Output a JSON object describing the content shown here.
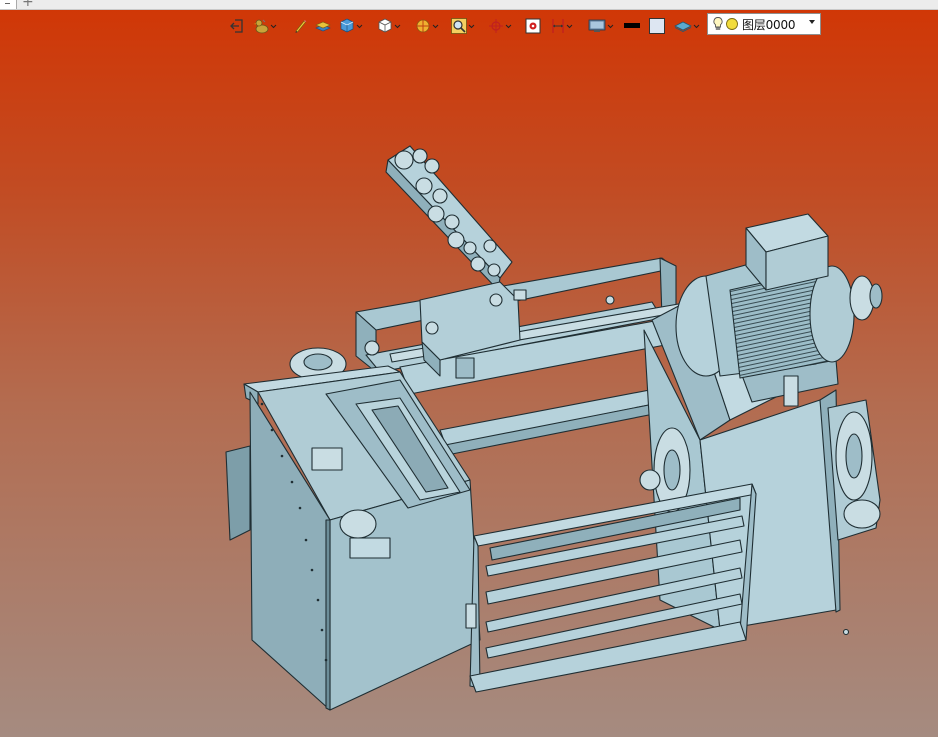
{
  "tab_strip": {
    "new_tab_label": "+"
  },
  "toolbar": {
    "icons": [
      "exit-icon",
      "duck-icon",
      "pencil-icon",
      "layers-icon",
      "cube-blue-icon",
      "cube-white-icon",
      "section-icon",
      "zoom-icon",
      "crosshair-icon",
      "target-icon",
      "dimension-icon",
      "display-icon",
      "black-color-icon",
      "light-color-icon",
      "plane-icon"
    ],
    "layer_select": {
      "value": "图层0000",
      "bulb_icon": "lightbulb-icon",
      "status_icon": "yellow-circle-icon"
    }
  },
  "viewport": {
    "model": "3d-machine-assembly",
    "background_colors": [
      "#d13605",
      "#a58b80"
    ],
    "model_color": "#9fc0cb"
  }
}
